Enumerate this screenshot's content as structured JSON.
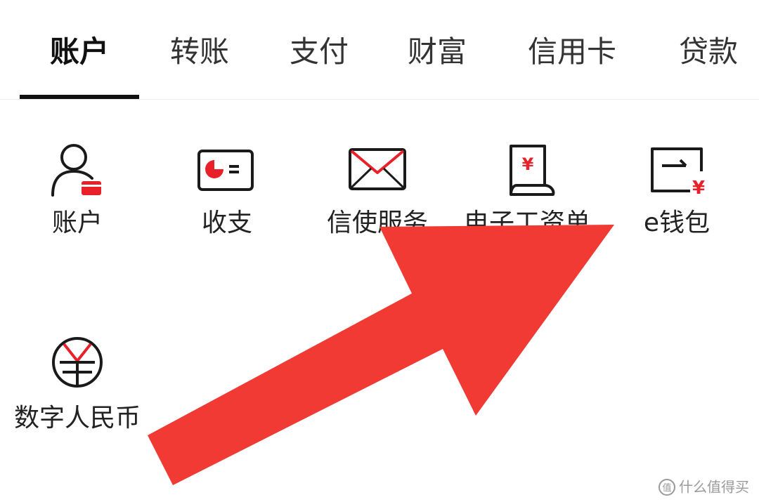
{
  "tabs": [
    {
      "label": "账户",
      "active": true
    },
    {
      "label": "转账",
      "active": false
    },
    {
      "label": "支付",
      "active": false
    },
    {
      "label": "财富",
      "active": false
    },
    {
      "label": "信用卡",
      "active": false
    },
    {
      "label": "贷款",
      "active": false
    }
  ],
  "grid": [
    {
      "icon": "account-icon",
      "label": "账户"
    },
    {
      "icon": "income-expense-icon",
      "label": "收支"
    },
    {
      "icon": "envelope-icon",
      "label": "信使服务"
    },
    {
      "icon": "payslip-icon",
      "label": "电子工资单"
    },
    {
      "icon": "e-wallet-icon",
      "label": "e钱包"
    },
    {
      "icon": "digital-rmb-icon",
      "label": "数字人民币"
    }
  ],
  "colors": {
    "accent": "#e8202a",
    "annotation_arrow": "#f03a33",
    "icon_stroke": "#1a1a1a",
    "active_tab_underline": "#111111"
  },
  "watermark": {
    "text": "什么值得买"
  }
}
